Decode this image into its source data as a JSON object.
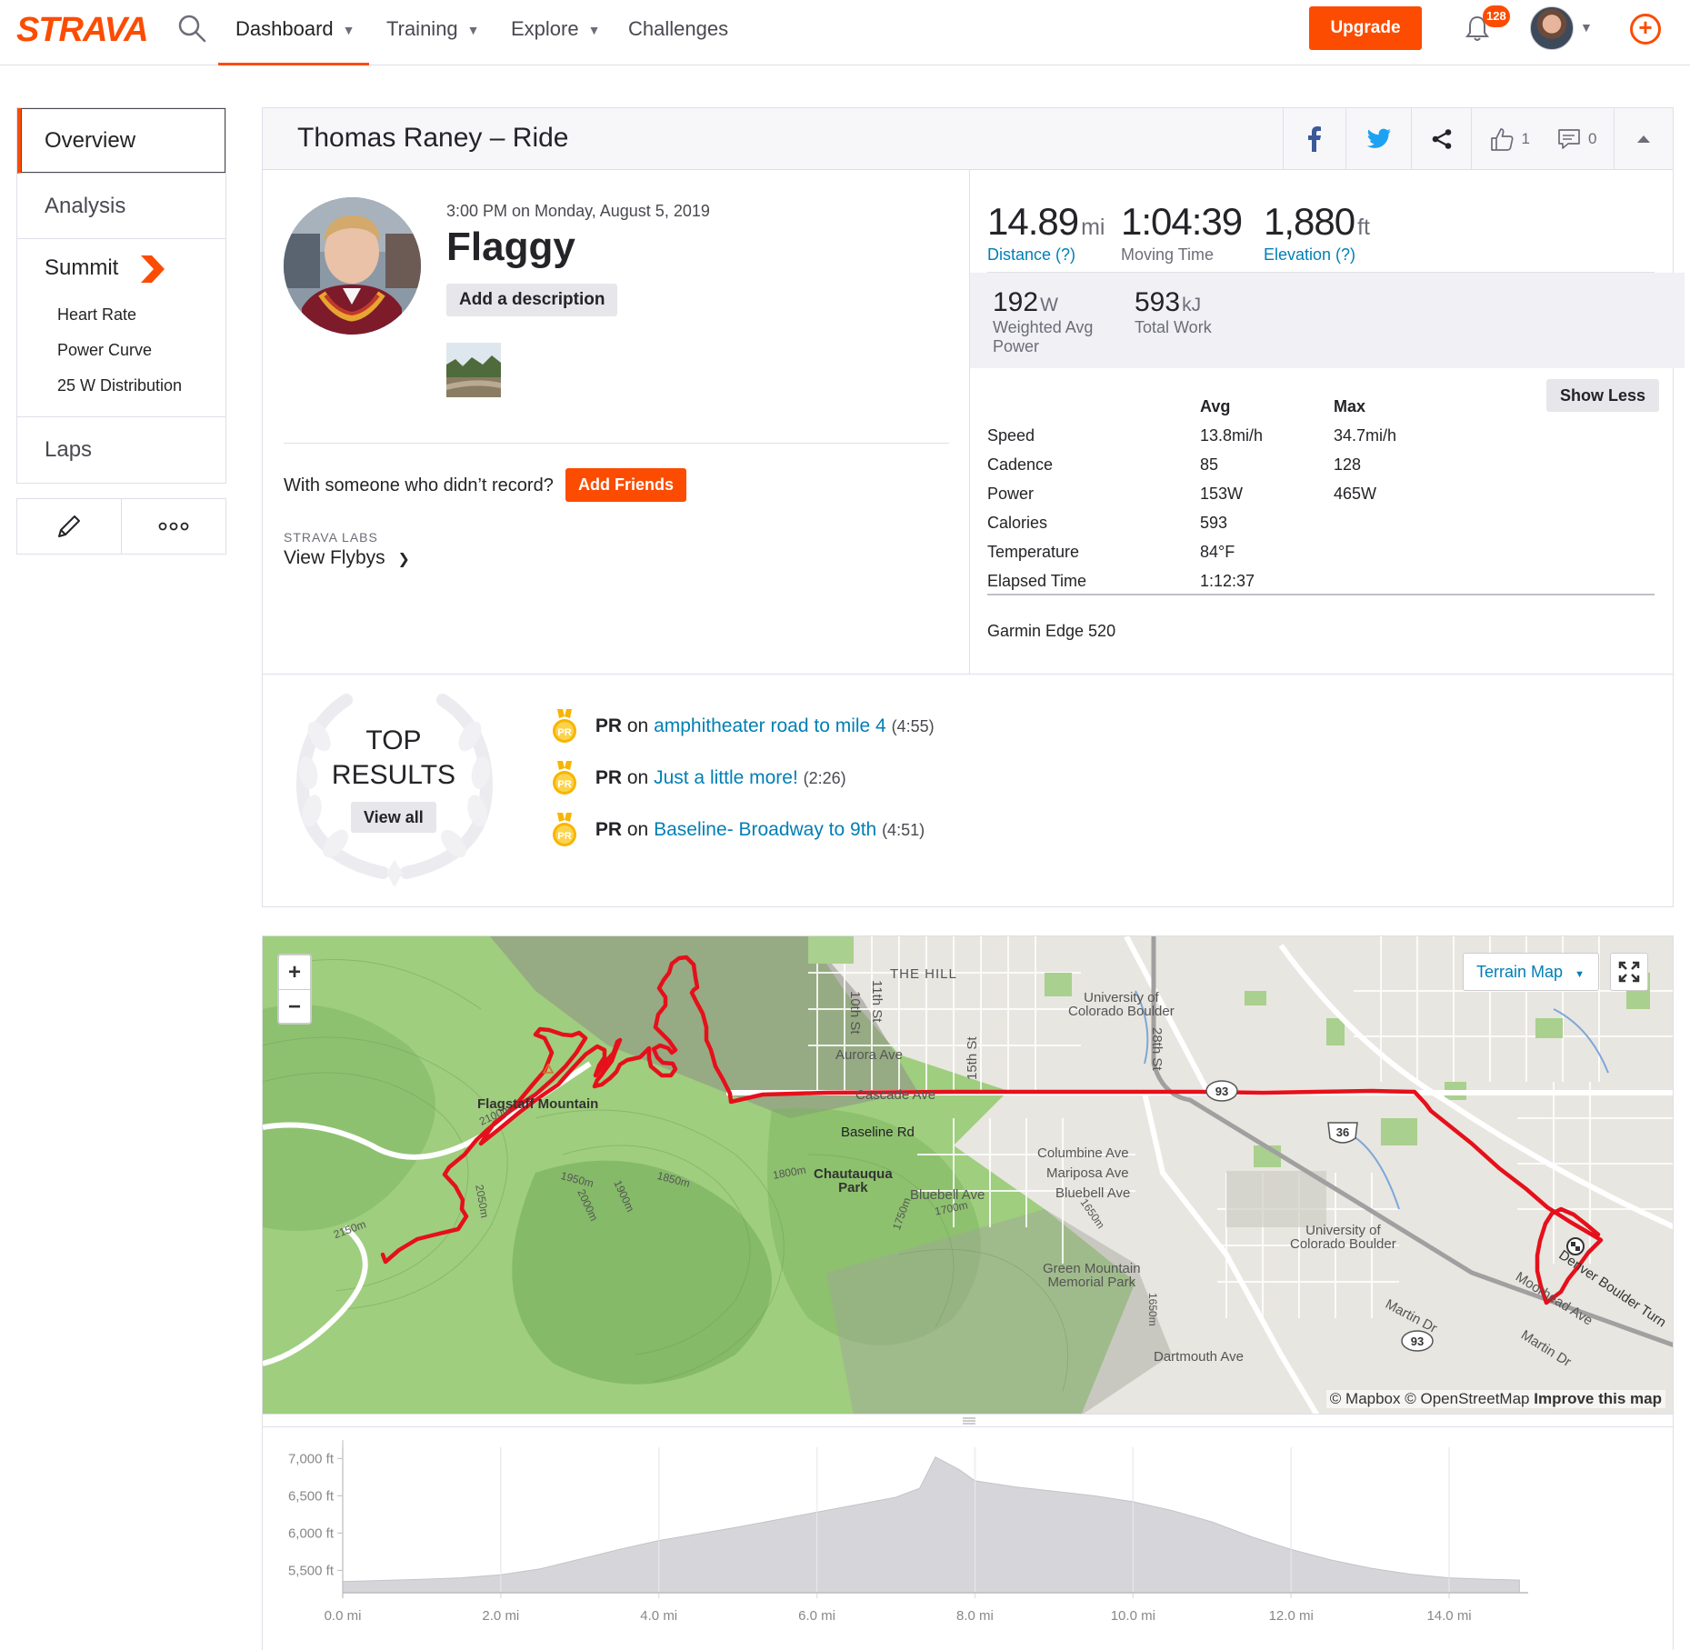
{
  "nav": {
    "logo": "STRAVA",
    "items": [
      {
        "label": "Dashboard",
        "has_menu": true,
        "active": true
      },
      {
        "label": "Training",
        "has_menu": true
      },
      {
        "label": "Explore",
        "has_menu": true
      },
      {
        "label": "Challenges",
        "has_menu": false
      }
    ],
    "upgrade": "Upgrade",
    "notifications_count": "128",
    "accent_color": "#fc4c02",
    "icons": [
      "search-icon",
      "bell-icon",
      "avatar",
      "chevron-down-icon",
      "plus-circle-icon"
    ]
  },
  "sidebar": {
    "overview": "Overview",
    "analysis": "Analysis",
    "summit": "Summit",
    "summit_sub": [
      "Heart Rate",
      "Power Curve",
      "25 W Distribution"
    ],
    "laps": "Laps",
    "tools": [
      "pencil-icon",
      "more-icon"
    ]
  },
  "activity": {
    "title": "Thomas Raney – Ride",
    "header_icons": [
      "facebook-icon",
      "twitter-icon",
      "share-icon",
      "kudos-icon",
      "comment-icon",
      "collapse-icon"
    ],
    "kudos": "1",
    "comments": "0",
    "time": "3:00 PM on Monday, August 5, 2019",
    "name": "Flaggy",
    "add_description": "Add a description",
    "with_someone": "With someone who didn’t record?",
    "add_friends": "Add Friends",
    "labs_label": "STRAVA LABS",
    "view_flybys": "View Flybys"
  },
  "stats": {
    "distance": {
      "value": "14.89",
      "unit": "mi",
      "label": "Distance (?)"
    },
    "moving_time": {
      "value": "1:04:39",
      "label": "Moving Time"
    },
    "elevation": {
      "value": "1,880",
      "unit": "ft",
      "label": "Elevation (?)"
    },
    "weighted_power": {
      "value": "192",
      "unit": "W",
      "label": "Weighted Avg Power"
    },
    "total_work": {
      "value": "593",
      "unit": "kJ",
      "label": "Total Work"
    },
    "table": {
      "headers": [
        "Avg",
        "Max"
      ],
      "rows": [
        {
          "label": "Speed",
          "avg": "13.8mi/h",
          "max": "34.7mi/h"
        },
        {
          "label": "Cadence",
          "avg": "85",
          "max": "128"
        },
        {
          "label": "Power",
          "avg": "153W",
          "max": "465W"
        },
        {
          "label": "Calories",
          "avg": "593",
          "max": ""
        },
        {
          "label": "Temperature",
          "avg": "84°F",
          "max": ""
        },
        {
          "label": "Elapsed Time",
          "avg": "1:12:37",
          "max": ""
        }
      ]
    },
    "show_less": "Show Less",
    "device": "Garmin Edge 520"
  },
  "results": {
    "title_line1": "TOP",
    "title_line2": "RESULTS",
    "view_all": "View all",
    "items": [
      {
        "badge": "PR",
        "pr": "PR",
        "on": "on",
        "segment": "amphitheater road to mile 4",
        "time": "(4:55)"
      },
      {
        "badge": "PR",
        "pr": "PR",
        "on": "on",
        "segment": "Just a little more!",
        "time": "(2:26)"
      },
      {
        "badge": "PR",
        "pr": "PR",
        "on": "on",
        "segment": "Baseline- Broadway to 9th",
        "time": "(4:51)"
      }
    ]
  },
  "map": {
    "zoom_in": "+",
    "zoom_out": "−",
    "map_type": "Terrain Map",
    "attribution_prefix": "© Mapbox © OpenStreetMap",
    "attribution_link": "Improve this map",
    "labels": {
      "flagstaff": "Flagstaff Mountain",
      "the_hill": "THE HILL",
      "tenth": "10th St",
      "eleventh": "11th St",
      "fifteenth": "15th St",
      "twentyeighth": "28th St",
      "university_a_1": "University of",
      "university_a_2": "Colorado Boulder",
      "university_b_1": "University of",
      "university_b_2": "Colorado Boulder",
      "aurora": "Aurora Ave",
      "cascade": "Cascade Ave",
      "baseline": "Baseline Rd",
      "chautauqua_1": "Chautauqua",
      "chautauqua_2": "Park",
      "columbine": "Columbine Ave",
      "mariposa": "Mariposa Ave",
      "bluebell_1": "Bluebell Ave",
      "bluebell_2": "Bluebell Ave",
      "green_mtn_1": "Green Mountain",
      "green_mtn_2": "Memorial Park",
      "dartmouth": "Dartmouth Ave",
      "martin_1": "Martin Dr",
      "martin_2": "Martin Dr",
      "moorhead": "Moorhead Ave",
      "denver_boulder": "Denver Boulder Turn",
      "route_93": "93",
      "route_36": "36",
      "route_93b": "93",
      "c2100": "2100m",
      "c2050": "2050m",
      "c2150": "2150m",
      "c1950": "1950m",
      "c2000": "2000m",
      "c1900": "1900m",
      "c1850": "1850m",
      "c1800": "1800m",
      "c1750": "1750m",
      "c1700": "1700m",
      "c1650": "1650m",
      "c1650b": "1650m"
    }
  },
  "chart_data": {
    "type": "area",
    "title": "",
    "xlabel": "",
    "ylabel": "",
    "x_ticks": [
      "0.0 mi",
      "2.0 mi",
      "4.0 mi",
      "6.0 mi",
      "8.0 mi",
      "10.0 mi",
      "12.0 mi",
      "14.0 mi"
    ],
    "y_ticks": [
      "7,000 ft",
      "6,500 ft",
      "6,000 ft",
      "5,500 ft"
    ],
    "xlim": [
      0,
      15
    ],
    "ylim": [
      5200,
      7150
    ],
    "x": [
      0,
      0.5,
      1.0,
      1.5,
      2.0,
      2.5,
      3.0,
      3.5,
      4.0,
      4.5,
      5.0,
      5.5,
      6.0,
      6.5,
      7.0,
      7.3,
      7.5,
      7.8,
      8.0,
      8.5,
      9.0,
      9.5,
      10.0,
      10.5,
      11.0,
      11.5,
      12.0,
      12.5,
      13.0,
      13.5,
      14.0,
      14.5,
      14.89
    ],
    "series": [
      {
        "values": [
          5350,
          5365,
          5380,
          5400,
          5440,
          5520,
          5650,
          5780,
          5900,
          5990,
          6080,
          6180,
          6280,
          6380,
          6480,
          6600,
          7020,
          6850,
          6700,
          6620,
          6560,
          6500,
          6420,
          6300,
          6150,
          5950,
          5780,
          5640,
          5530,
          5450,
          5400,
          5380,
          5370
        ]
      }
    ],
    "grid": true,
    "fill_color": "#d6d6da"
  }
}
